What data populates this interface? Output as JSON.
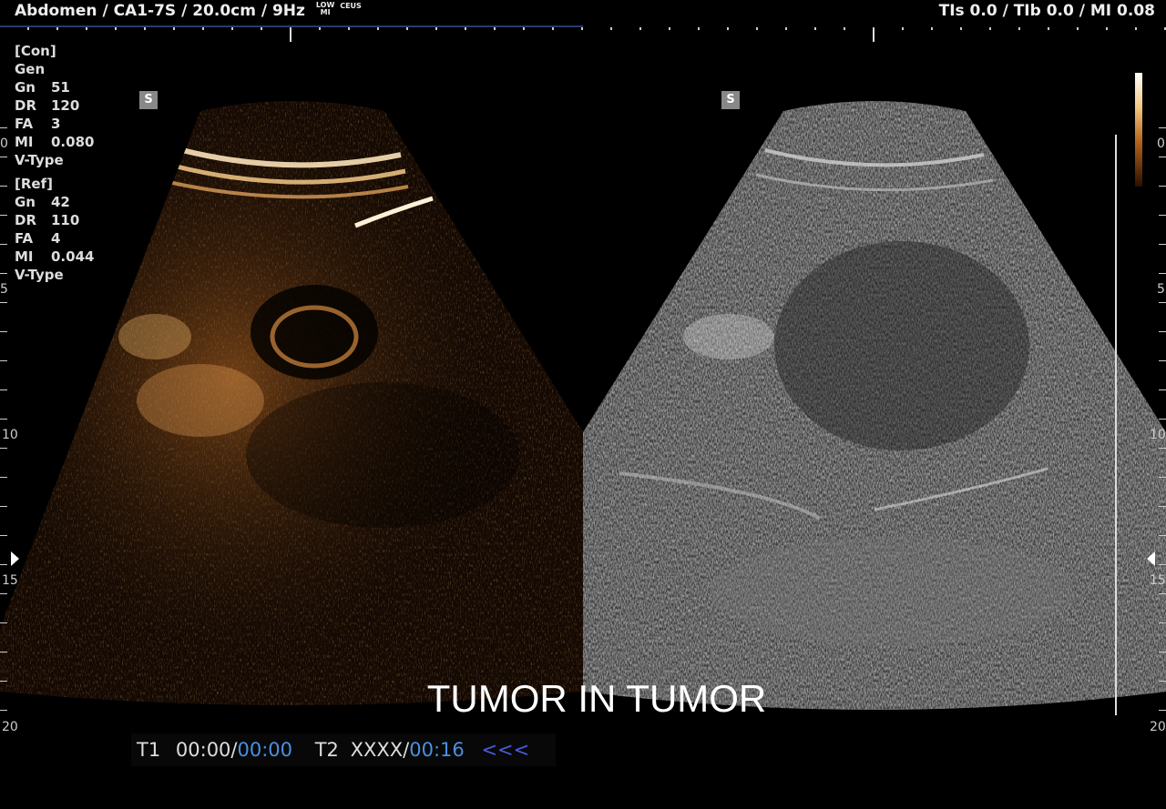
{
  "header": {
    "title": "Abdomen / CA1-7S / 20.0cm / 9Hz",
    "mode_top": "LOW",
    "mode_bottom": "MI",
    "mode_label": "CEUS",
    "right": "TIs  0.0 / TIb  0.0 / MI  0.08"
  },
  "params": {
    "con_header": "[Con]",
    "gen": "Gen",
    "con": [
      {
        "k": "Gn",
        "v": "51"
      },
      {
        "k": "DR",
        "v": "120"
      },
      {
        "k": "FA",
        "v": "3"
      },
      {
        "k": "MI",
        "v": "0.080"
      }
    ],
    "con_vtype": "V-Type",
    "ref_header": "[Ref]",
    "ref": [
      {
        "k": "Gn",
        "v": "42"
      },
      {
        "k": "DR",
        "v": "110"
      },
      {
        "k": "FA",
        "v": "4"
      },
      {
        "k": "MI",
        "v": "0.044"
      }
    ],
    "ref_vtype": "V-Type"
  },
  "badges": {
    "left": "S",
    "right": "S"
  },
  "depth_labels": [
    "0",
    "5",
    "10",
    "15",
    "20"
  ],
  "caption": "TUMOR IN TUMOR",
  "timer": {
    "t1_label": "T1",
    "t1_value": "00:00",
    "sep": "/",
    "t1_total": "00:00",
    "t2_label": "T2",
    "t2_value": "XXXX",
    "t2_total": "00:16",
    "arrows": "<<<"
  },
  "colors": {
    "contrast": "#e08a35",
    "bmode": "#9a9a9a",
    "accent": "#4a8fe0"
  }
}
